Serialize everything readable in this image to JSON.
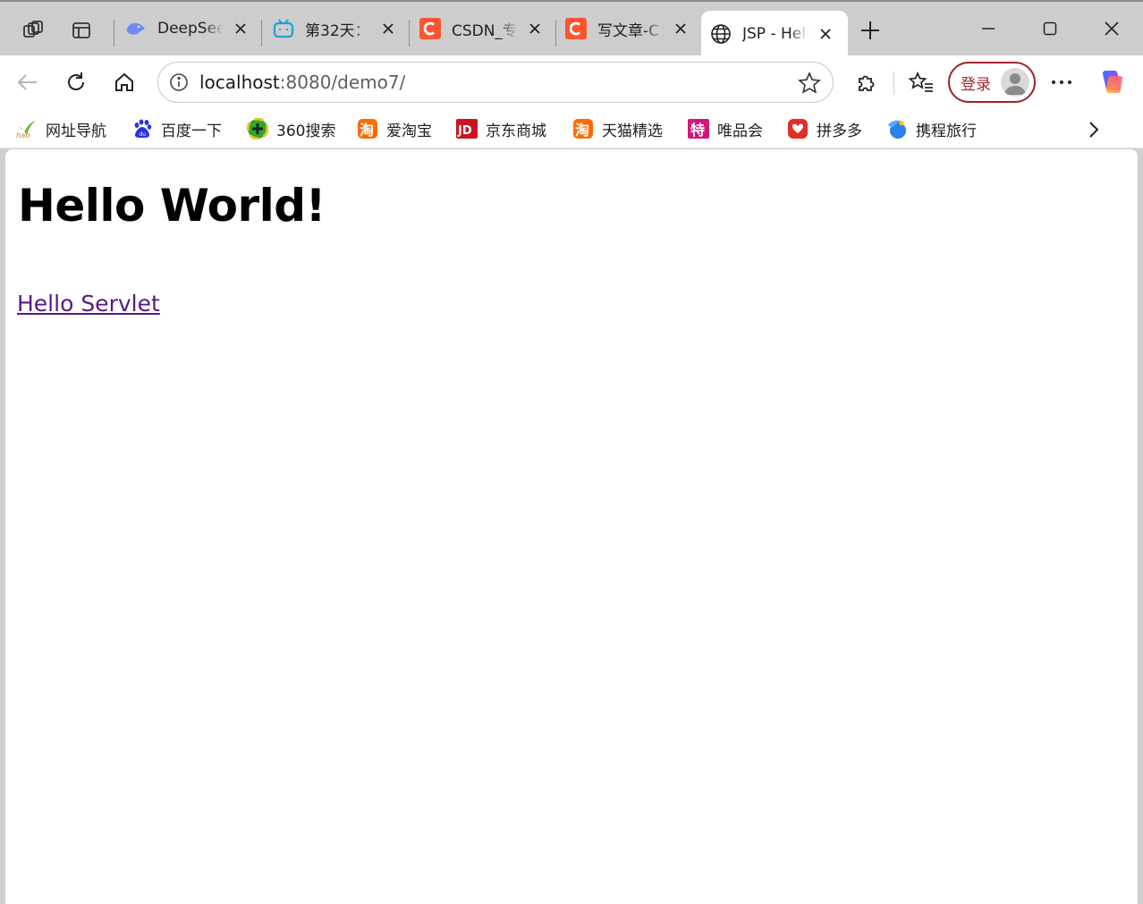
{
  "tabs": [
    {
      "title": "DeepSeek",
      "icon": "deepseek-whale-icon"
    },
    {
      "title": "第32天：",
      "icon": "bilibili-tv-icon"
    },
    {
      "title": "CSDN_专",
      "icon": "csdn-logo-icon"
    },
    {
      "title": "写文章-C",
      "icon": "csdn-logo-icon"
    },
    {
      "title": "JSP - Hello",
      "icon": "globe-icon",
      "active": true
    }
  ],
  "address": {
    "host": "localhost",
    "rest": ":8080/demo7/"
  },
  "login": {
    "label": "登录"
  },
  "bookmarks": [
    {
      "label": "网址导航",
      "icon": "hao-nav-icon"
    },
    {
      "label": "百度一下",
      "icon": "baidu-paw-icon"
    },
    {
      "label": "360搜索",
      "icon": "360-search-icon"
    },
    {
      "label": "爱淘宝",
      "icon": "taobao-icon"
    },
    {
      "label": "京东商城",
      "icon": "jd-icon"
    },
    {
      "label": "天猫精选",
      "icon": "tmall-icon"
    },
    {
      "label": "唯品会",
      "icon": "vip-icon"
    },
    {
      "label": "拼多多",
      "icon": "pinduoduo-icon"
    },
    {
      "label": "携程旅行",
      "icon": "ctrip-icon"
    }
  ],
  "page": {
    "heading": "Hello World!",
    "link": "Hello Servlet"
  },
  "colors": {
    "accent_login": "#a0262a",
    "link_visited": "#551a8b",
    "csdn_red": "#fc5531",
    "tabstrip_bg": "#cdcdcd"
  }
}
